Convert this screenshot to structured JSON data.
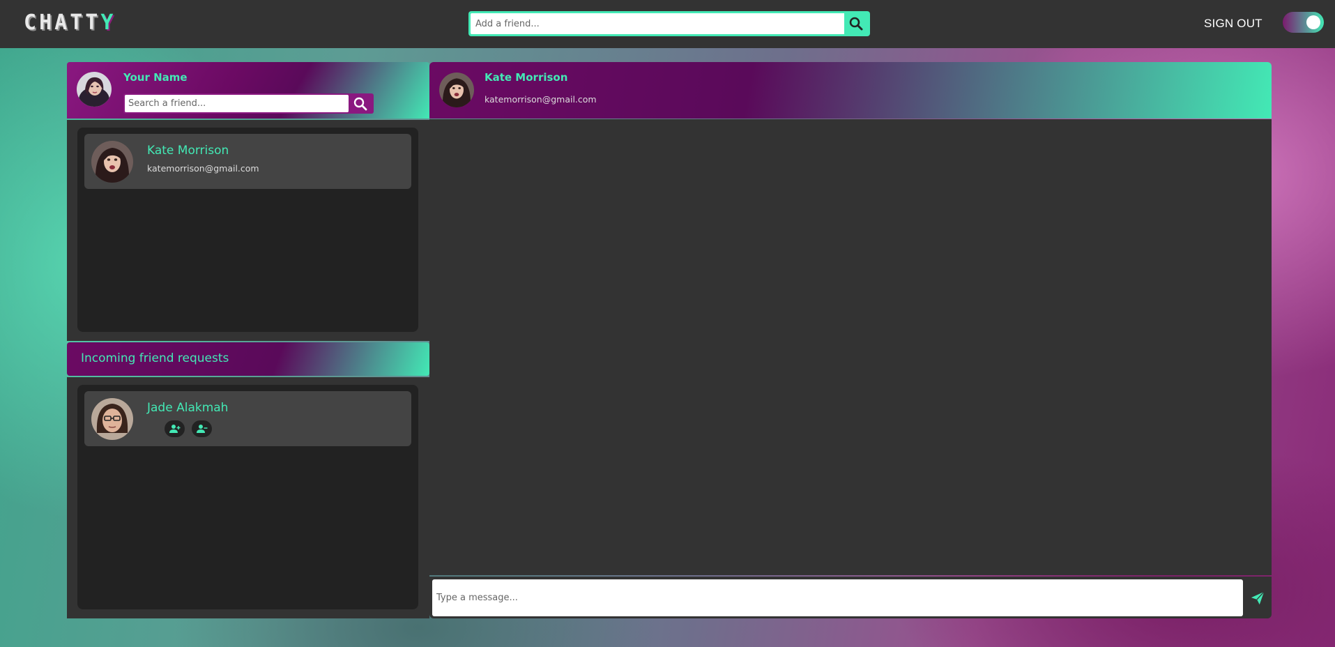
{
  "app": {
    "logo_letters": [
      "C",
      "H",
      "A",
      "T",
      "T",
      "Y"
    ],
    "accent_color": "#43e9b5",
    "brand_purple": "#6b0a63"
  },
  "topbar": {
    "add_friend_placeholder": "Add a friend...",
    "sign_out_label": "SIGN OUT",
    "theme_toggle_on": true,
    "search_icon": "search-icon"
  },
  "profile": {
    "name": "Your Name",
    "search_placeholder": "Search a friend...",
    "avatar": "avatar"
  },
  "friends": [
    {
      "name": "Kate Morrison",
      "email": "katemorrison@gmail.com"
    }
  ],
  "requests": {
    "title": "Incoming friend requests",
    "items": [
      {
        "name": "Jade Alakmah",
        "accept_icon": "user-plus-icon",
        "decline_icon": "user-minus-icon"
      }
    ]
  },
  "chat": {
    "contact_name": "Kate Morrison",
    "contact_email": "katemorrison@gmail.com",
    "message_placeholder": "Type a message...",
    "send_icon": "send-icon"
  }
}
